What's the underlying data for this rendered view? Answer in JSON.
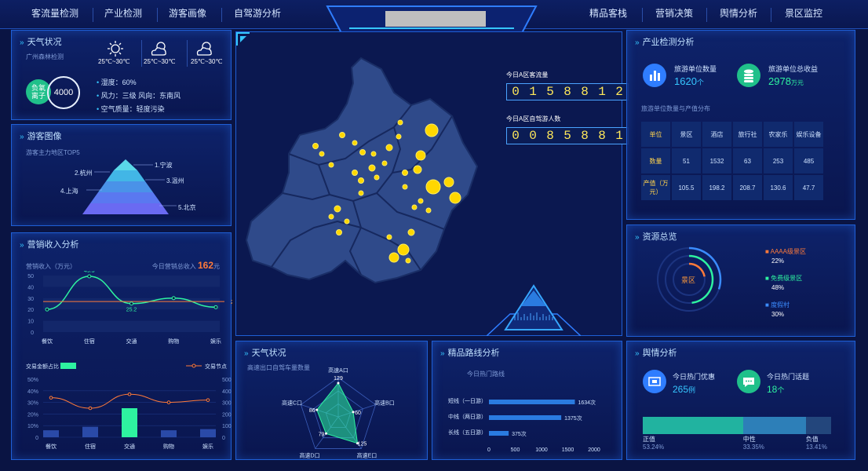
{
  "nav": {
    "left": [
      "客流量检测",
      "产业检测",
      "游客画像",
      "自驾游分析"
    ],
    "right": [
      "精品客栈",
      "营销决策",
      "舆情分析",
      "景区监控"
    ]
  },
  "colors": {
    "bg": "#0a1443",
    "accent": "#36c6ff",
    "yellow": "#ffd700",
    "green": "#2ef2a0",
    "orange": "#ff7a3a"
  },
  "weather": {
    "title": "天气状况",
    "location": "广州森林检测",
    "days": [
      {
        "icon": "sun-icon",
        "temp": "25℃~30℃"
      },
      {
        "icon": "partly-cloudy-icon",
        "temp": "25℃~30℃"
      },
      {
        "icon": "partly-cloudy-icon",
        "temp": "25℃~30℃"
      }
    ],
    "ion_label": "负氧\n离子",
    "ion_value": "4000",
    "details": [
      "湿度：60%",
      "风力：三级  风向：东南风",
      "空气质量：轻度污染"
    ]
  },
  "visitor_image": {
    "title": "游客图像",
    "subtitle": "游客主力地区TOP5",
    "labels": [
      "1.宁波",
      "2.杭州",
      "3.温州",
      "4.上海",
      "5.北京"
    ]
  },
  "marketing": {
    "title": "营销收入分析",
    "unit_label": "营销收入（万元）",
    "today_label": "今日营销总收入",
    "today_value": "162",
    "today_unit": "元",
    "line_chart": {
      "categories": [
        "餐饮",
        "住宿",
        "交通",
        "购物",
        "娱乐"
      ],
      "values": [
        20,
        49.3,
        25.2,
        30,
        22
      ],
      "ylim": [
        0,
        50
      ],
      "yticks": [
        "0",
        "10",
        "20",
        "30",
        "40",
        "50"
      ],
      "labels": [
        "49.3",
        "25.2"
      ],
      "avg_value": 27,
      "avg_label": "27"
    },
    "bar_chart": {
      "legend_bar": "交易金额占比",
      "legend_line": "交易节点",
      "categories": [
        "餐饮",
        "住宿",
        "交通",
        "购物",
        "娱乐"
      ],
      "bar_values": [
        6,
        9,
        25,
        6,
        7
      ],
      "line_values": [
        340,
        250,
        370,
        300,
        320
      ],
      "yticks_left": [
        "0",
        "10%",
        "20%",
        "30%",
        "40%",
        "50%"
      ],
      "yticks_right": [
        "0",
        "100",
        "200",
        "300",
        "400",
        "500"
      ]
    }
  },
  "map": {
    "a_visitors_label": "今日A区客流量",
    "a_visitors_digits": [
      "0",
      "1",
      "5",
      "8",
      "8",
      "1",
      "2"
    ],
    "a_self_drive_label": "今日A区自驾游人数",
    "a_self_drive_digits": [
      "0",
      "0",
      "8",
      "5",
      "8",
      "8",
      "1"
    ]
  },
  "industry": {
    "title": "产业检测分析",
    "stat1_label": "旅游单位数量",
    "stat1_value": "1620",
    "stat1_unit": "个",
    "stat2_label": "旅游单位总收益",
    "stat2_value": "2978",
    "stat2_unit": "万元",
    "table_title": "旅游单位数量与产值分布",
    "table": {
      "headers": [
        "单位",
        "景区",
        "酒店",
        "旅行社",
        "农家乐",
        "娱乐设备"
      ],
      "rows": [
        [
          "数量",
          "51",
          "1532",
          "63",
          "253",
          "485"
        ],
        [
          "产值（万元）",
          "105.5",
          "198.2",
          "208.7",
          "130.6",
          "47.7"
        ]
      ]
    }
  },
  "resources": {
    "title": "资源总览",
    "center": "景区",
    "items": [
      {
        "label": "AAAA级景区",
        "value": "22%",
        "color": "#ff7a3a"
      },
      {
        "label": "免费级景区",
        "value": "48%",
        "color": "#2ef2a0"
      },
      {
        "label": "度假村",
        "value": "30%",
        "color": "#3b8cff"
      }
    ]
  },
  "radar": {
    "title": "天气状况",
    "subtitle": "高速出口自驾车量数量",
    "axes": [
      "高速A口",
      "高速B口",
      "高速E口",
      "高速D口",
      "高速C口"
    ],
    "values": [
      129,
      60,
      125,
      79,
      86
    ]
  },
  "routes": {
    "title": "精品路线分析",
    "subtitle": "今日热门路线",
    "items": [
      {
        "label": "短线（一日游）",
        "value": 1634,
        "value_label": "1634次"
      },
      {
        "label": "中线（两日游）",
        "value": 1375,
        "value_label": "1375次"
      },
      {
        "label": "长线（五日游）",
        "value": 375,
        "value_label": "375次"
      }
    ],
    "xticks": [
      "0",
      "500",
      "1000",
      "1500",
      "2000"
    ],
    "xmax": 2000
  },
  "sentiment": {
    "title": "舆情分析",
    "stat1_label": "今日热门优惠",
    "stat1_value": "265",
    "stat1_unit": "例",
    "stat2_label": "今日热门话题",
    "stat2_value": "18",
    "stat2_unit": "个",
    "segments": [
      {
        "label": "正值",
        "pct": "53.24%",
        "value": 53.24,
        "color": "#21b3a0"
      },
      {
        "label": "中性",
        "pct": "33.35%",
        "value": 33.35,
        "color": "#2d7fb8"
      },
      {
        "label": "负值",
        "pct": "13.41%",
        "value": 13.41,
        "color": "#23467c"
      }
    ]
  }
}
